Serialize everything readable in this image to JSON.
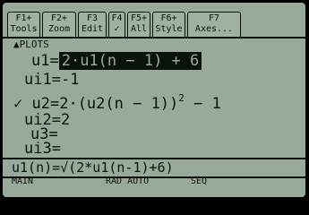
{
  "toolbar": [
    {
      "key": "F1+",
      "label": "Tools"
    },
    {
      "key": "F2+",
      "label": "Zoom"
    },
    {
      "key": "F3",
      "label": "Edit"
    },
    {
      "key": "F4",
      "label": "✓"
    },
    {
      "key": "F5+",
      "label": "All"
    },
    {
      "key": "F6+",
      "label": "Style"
    },
    {
      "key": "F7",
      "label": "Axes..."
    }
  ],
  "plots_label": "▲PLOTS",
  "sequences": {
    "u1_label": "u1=",
    "u1_expr": "2·u1(n − 1) + 6",
    "ui1_label": "ui1=",
    "ui1_value": "-1",
    "u2_check": "✓",
    "u2_label": "u2=",
    "u2_expr_pre": "2·(u2(n − 1))",
    "u2_exp": "2",
    "u2_expr_post": " − 1",
    "ui2_label": "ui2=",
    "ui2_value": "2",
    "u3_label": "u3=",
    "ui3_label": "ui3="
  },
  "command_line": "u1(n)=√(2*u1(n-1)+6)",
  "status_bar": {
    "mode": "MAIN",
    "angle": "RAD AUTO",
    "graph": "SEQ"
  },
  "colors": {
    "lcd_background": "#98aa9a",
    "pixel": "#0b120b"
  }
}
